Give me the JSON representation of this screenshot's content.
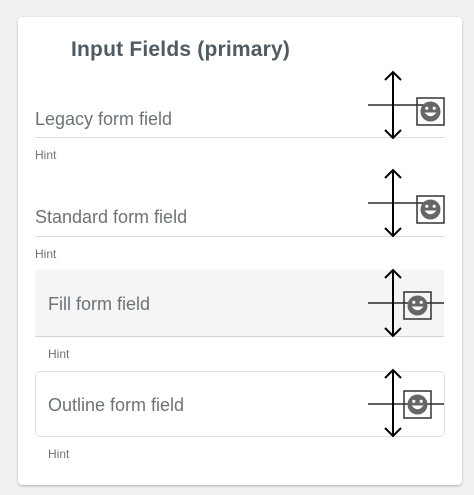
{
  "card": {
    "title": "Input Fields (primary)"
  },
  "fields": [
    {
      "label": "Legacy form field",
      "hint": "Hint",
      "appearance": "legacy",
      "suffix_icon": "smiley-icon"
    },
    {
      "label": "Standard form field",
      "hint": "Hint",
      "appearance": "standard",
      "suffix_icon": "smiley-icon"
    },
    {
      "label": "Fill form field",
      "hint": "Hint",
      "appearance": "fill",
      "suffix_icon": "smiley-icon"
    },
    {
      "label": "Outline form field",
      "hint": "Hint",
      "appearance": "outline",
      "suffix_icon": "smiley-icon"
    }
  ],
  "colors": {
    "text": "#6c7378",
    "title": "#505a62",
    "fill_background": "#f5f5f5",
    "divider": "#dcdcdc"
  }
}
